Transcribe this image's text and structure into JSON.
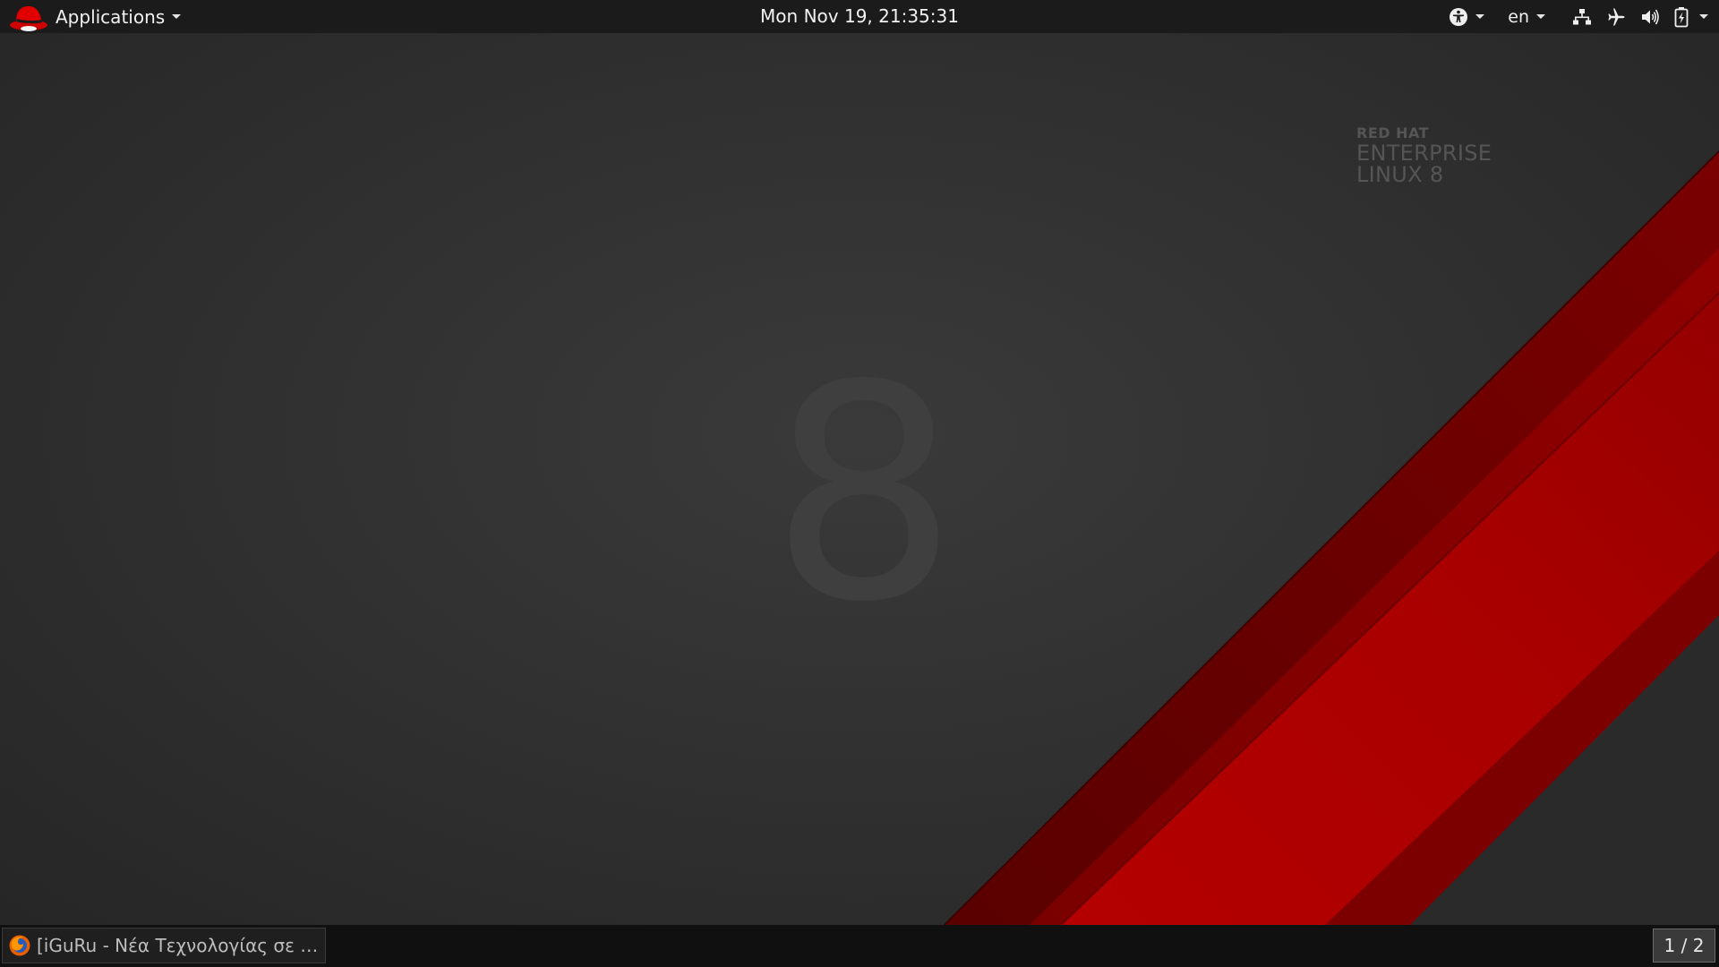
{
  "topbar": {
    "applications_label": "Applications",
    "clock": "Mon Nov 19, 21:35:31",
    "language": "en",
    "icons": {
      "logo": "redhat-logo-icon",
      "accessibility": "accessibility-icon",
      "network": "network-wired-icon",
      "airplane": "airplane-mode-icon",
      "volume": "volume-icon",
      "battery": "battery-charging-icon"
    }
  },
  "desktop": {
    "brand": {
      "line1": "RED HAT",
      "line2": "ENTERPRISE",
      "line3": "LINUX 8"
    },
    "big_number": "8",
    "colors": {
      "background": "#2c2c2c",
      "stripe_dark": "#6a0000",
      "stripe_mid": "#8e0000",
      "stripe_bright": "#c00000"
    }
  },
  "taskbar": {
    "window_title": "[iGuRu - Νέα Τεχνολογίας σε π...",
    "window_icon": "firefox-icon",
    "workspace": "1 / 2"
  }
}
